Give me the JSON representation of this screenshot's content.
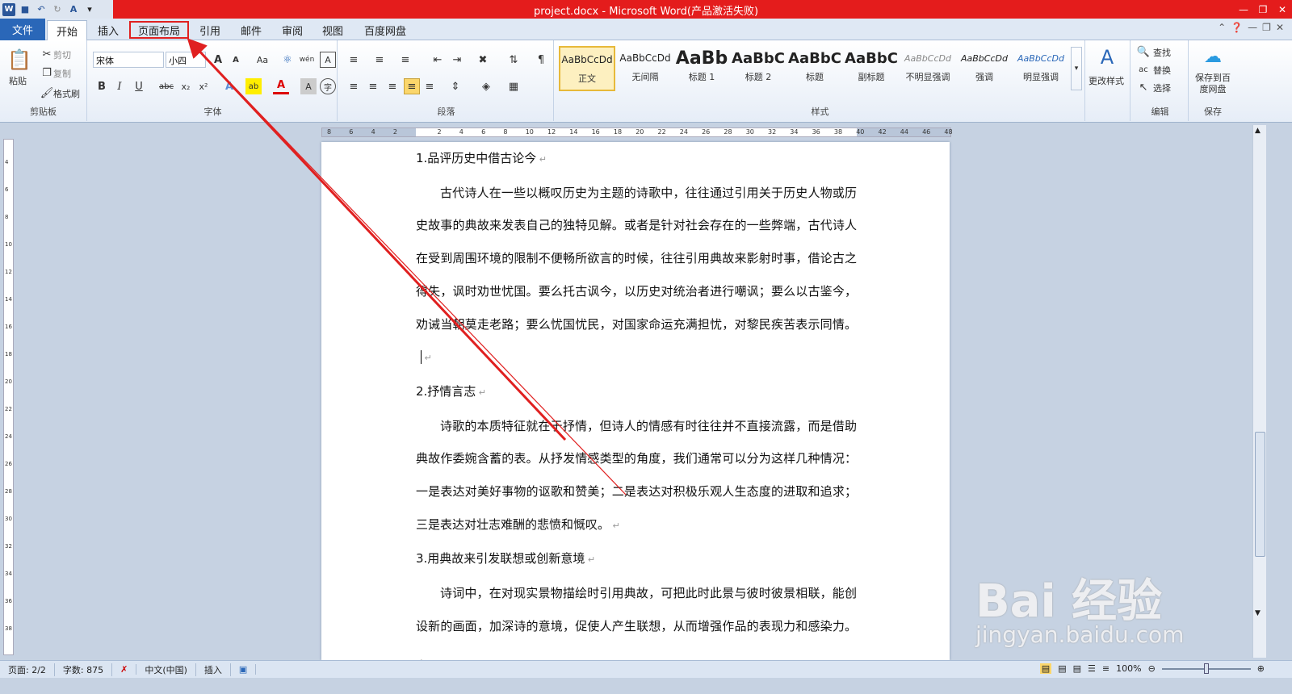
{
  "window": {
    "title": "project.docx  -  Microsoft Word(产品激活失败)"
  },
  "quick_access": {
    "icons": [
      "word-logo-icon",
      "save-icon",
      "undo-icon",
      "redo-icon",
      "font-color-icon",
      "customize-icon"
    ]
  },
  "tabs": [
    "文件",
    "开始",
    "插入",
    "页面布局",
    "引用",
    "邮件",
    "审阅",
    "视图",
    "百度网盘"
  ],
  "highlighted_tab": "页面布局",
  "ribbon": {
    "clipboard": {
      "label": "剪贴板",
      "paste": "粘贴",
      "cut": "剪切",
      "copy": "复制",
      "format_painter": "格式刷"
    },
    "font": {
      "label": "字体",
      "font_name": "宋体",
      "font_size": "小四"
    },
    "paragraph": {
      "label": "段落"
    },
    "styles": {
      "label": "样式",
      "items": [
        {
          "preview": "AaBbCcDd",
          "name": "正文"
        },
        {
          "preview": "AaBbCcDd",
          "name": "无间隔"
        },
        {
          "preview": "AaBb",
          "name": "标题 1"
        },
        {
          "preview": "AaBbC",
          "name": "标题 2"
        },
        {
          "preview": "AaBbC",
          "name": "标题"
        },
        {
          "preview": "AaBbC",
          "name": "副标题"
        },
        {
          "preview": "AaBbCcDd",
          "name": "不明显强调"
        },
        {
          "preview": "AaBbCcDd",
          "name": "强调"
        },
        {
          "preview": "AaBbCcDd",
          "name": "明显强调"
        }
      ],
      "change_styles": "更改样式"
    },
    "editing": {
      "label": "编辑",
      "find": "查找",
      "replace": "替换",
      "select": "选择"
    },
    "save": {
      "label": "保存",
      "save_to_baidu": "保存到百度网盘"
    }
  },
  "ruler": {
    "h_ticks": [
      "8",
      "6",
      "4",
      "2",
      "",
      "2",
      "4",
      "6",
      "8",
      "10",
      "12",
      "14",
      "16",
      "18",
      "20",
      "22",
      "24",
      "26",
      "28",
      "30",
      "32",
      "34",
      "36",
      "38",
      "40",
      "42",
      "44",
      "46",
      "48"
    ],
    "v_ticks": [
      "4",
      "6",
      "8",
      "10",
      "12",
      "14",
      "16",
      "18",
      "20",
      "22",
      "24",
      "26",
      "28",
      "30",
      "32",
      "34",
      "36",
      "38"
    ]
  },
  "document": {
    "paragraphs": [
      {
        "type": "heading",
        "text": "1.品评历史中借古论今"
      },
      {
        "type": "body",
        "text": "古代诗人在一些以概叹历史为主题的诗歌中，往往通过引用关于历史人物或历史故事的典故来发表自己的独特见解。或者是针对社会存在的一些弊端，古代诗人在受到周围环境的限制不便畅所欲言的时候，往往引用典故来影射时事，借论古之得失，讽时劝世忧国。要么托古讽今，以历史对统治者进行嘲讽；要么以古鉴今，劝诫当朝莫走老路；要么忧国忧民，对国家命运充满担忧，对黎民疾苦表示同情。"
      },
      {
        "type": "heading",
        "text": "2.抒情言志"
      },
      {
        "type": "body",
        "text": "诗歌的本质特征就在于抒情，但诗人的情感有时往往并不直接流露，而是借助典故作委婉含蓄的表。从抒发情感类型的角度，我们通常可以分为这样几种情况：一是表达对美好事物的讴歌和赞美；二是表达对积极乐观人生态度的进取和追求；三是表达对壮志难酬的悲愤和慨叹。"
      },
      {
        "type": "heading",
        "text": "3.用典故来引发联想或创新意境"
      },
      {
        "type": "body",
        "text": "诗词中，在对现实景物描绘时引用典故，可把此时此景与彼时彼景相联，能创设新的画面，加深诗的意境，促使人产生联想，从而增强作品的表现力和感染力。"
      }
    ]
  },
  "status": {
    "page": "页面: 2/2",
    "words": "字数: 875",
    "language": "中文(中国)",
    "mode": "插入",
    "zoom": "100%"
  },
  "watermark": {
    "main": "Bai 经验",
    "sub": "jingyan.baidu.com"
  },
  "colors": {
    "title_bar": "#e41c1c",
    "file_tab": "#2a67b8",
    "annotation": "#e02020"
  }
}
